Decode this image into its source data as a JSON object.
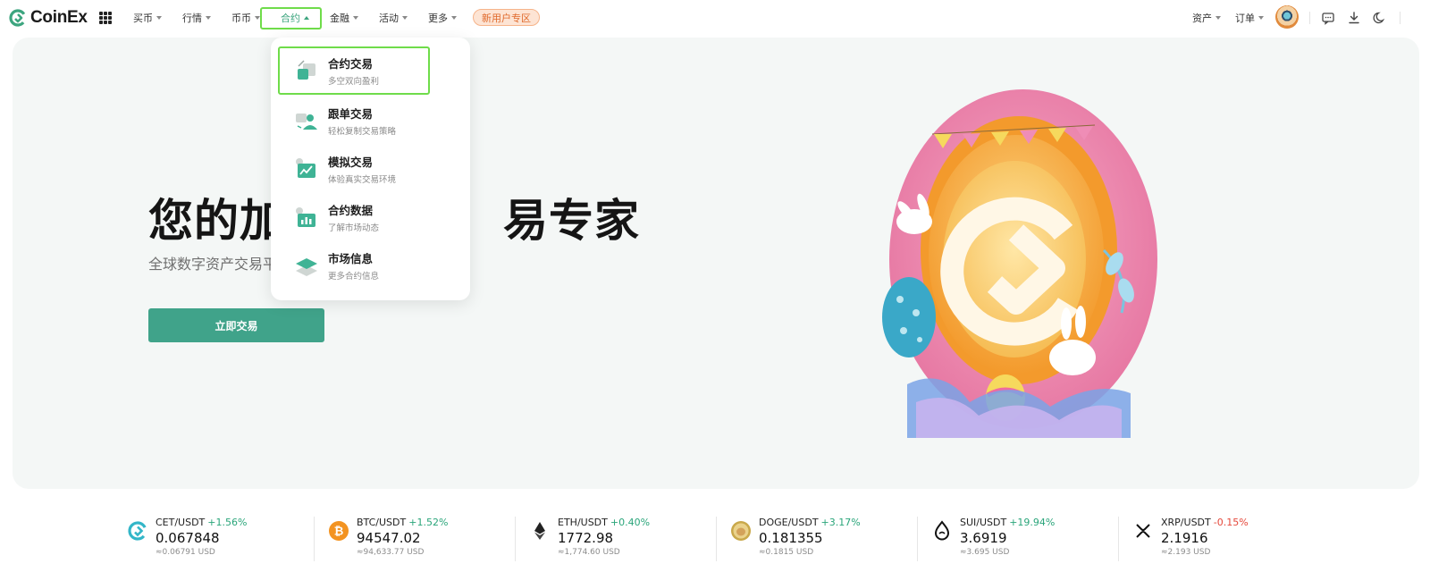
{
  "brand": {
    "name": "CoinEx",
    "accent": "#3da57f",
    "highlight": "#6fdc4a"
  },
  "nav": {
    "items": [
      {
        "label": "买币",
        "active": false
      },
      {
        "label": "行情",
        "active": false
      },
      {
        "label": "币币",
        "active": false
      },
      {
        "label": "合约",
        "active": true
      },
      {
        "label": "金融",
        "active": false
      },
      {
        "label": "活动",
        "active": false
      },
      {
        "label": "更多",
        "active": false
      }
    ],
    "promo": "新用户专区",
    "right": [
      {
        "label": "资产"
      },
      {
        "label": "订单"
      }
    ],
    "tool_icons": [
      "chat-icon",
      "download-icon",
      "moon-icon"
    ]
  },
  "dropdown": {
    "items": [
      {
        "title": "合约交易",
        "desc": "多空双向盈利",
        "icon": "futures-icon",
        "selected": true
      },
      {
        "title": "跟单交易",
        "desc": "轻松复制交易策略",
        "icon": "copy-trade-icon",
        "selected": false
      },
      {
        "title": "模拟交易",
        "desc": "体验真实交易环境",
        "icon": "demo-trade-icon",
        "selected": false
      },
      {
        "title": "合约数据",
        "desc": "了解市场动态",
        "icon": "data-chart-icon",
        "selected": false
      },
      {
        "title": "市场信息",
        "desc": "更多合约信息",
        "icon": "layers-icon",
        "selected": false
      }
    ]
  },
  "hero": {
    "title_left": "您的加",
    "title_right": "易专家",
    "subtitle": "全球数字资产交易平",
    "cta": "立即交易"
  },
  "tickers": [
    {
      "pair": "CET/USDT",
      "change": "+1.56%",
      "direction": "up",
      "price": "0.067848",
      "fiat": "≈0.06791 USD",
      "icon": "coinex-icon"
    },
    {
      "pair": "BTC/USDT",
      "change": "+1.52%",
      "direction": "up",
      "price": "94547.02",
      "fiat": "≈94,633.77 USD",
      "icon": "bitcoin-icon"
    },
    {
      "pair": "ETH/USDT",
      "change": "+0.40%",
      "direction": "up",
      "price": "1772.98",
      "fiat": "≈1,774.60 USD",
      "icon": "ethereum-icon"
    },
    {
      "pair": "DOGE/USDT",
      "change": "+3.17%",
      "direction": "up",
      "price": "0.181355",
      "fiat": "≈0.1815 USD",
      "icon": "dogecoin-icon"
    },
    {
      "pair": "SUI/USDT",
      "change": "+19.94%",
      "direction": "up",
      "price": "3.6919",
      "fiat": "≈3.695 USD",
      "icon": "sui-icon"
    },
    {
      "pair": "XRP/USDT",
      "change": "-0.15%",
      "direction": "down",
      "price": "2.1916",
      "fiat": "≈2.193 USD",
      "icon": "xrp-icon"
    }
  ]
}
